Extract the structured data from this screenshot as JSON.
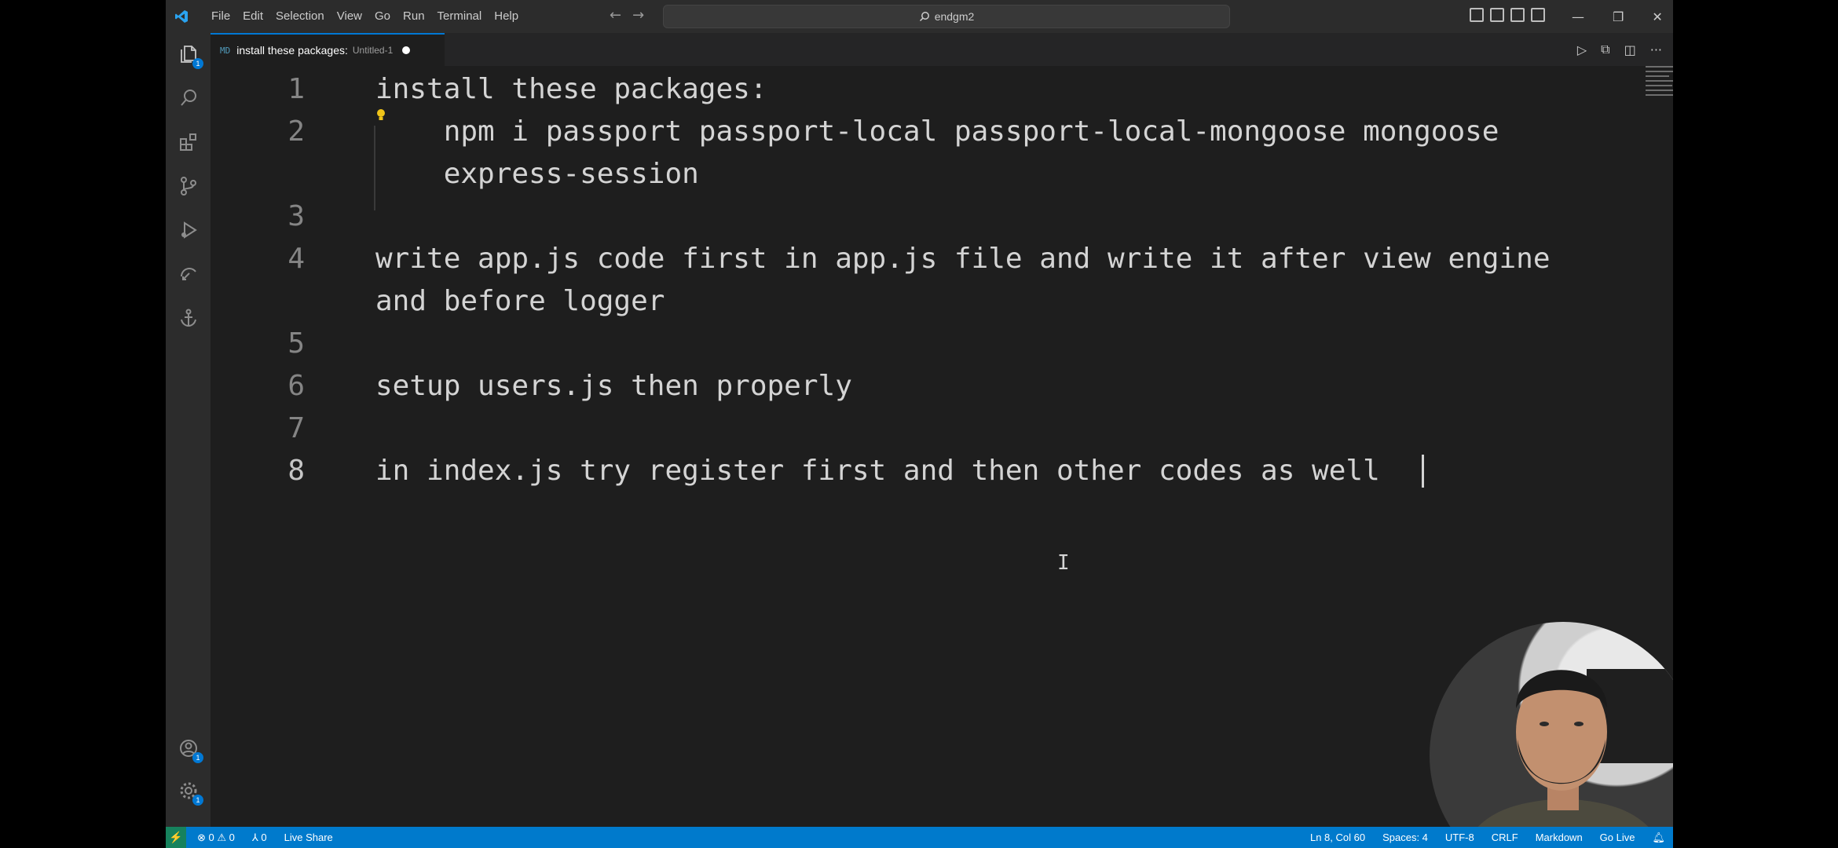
{
  "titlebar": {
    "menu": [
      "File",
      "Edit",
      "Selection",
      "View",
      "Go",
      "Run",
      "Terminal",
      "Help"
    ],
    "search_text": "endgm2",
    "icons": [
      "vscode-logo-icon",
      "back-arrow-icon",
      "forward-arrow-icon",
      "search-icon",
      "layout-icon",
      "minimize-icon",
      "restore-icon",
      "close-icon"
    ]
  },
  "activitybar": {
    "items": [
      {
        "name": "explorer-icon",
        "badge": "1"
      },
      {
        "name": "search-icon",
        "badge": ""
      },
      {
        "name": "extensions-icon",
        "badge": ""
      },
      {
        "name": "source-control-icon",
        "badge": ""
      },
      {
        "name": "run-debug-icon",
        "badge": ""
      },
      {
        "name": "remote-explorer-icon",
        "badge": ""
      },
      {
        "name": "anchor-icon",
        "badge": ""
      }
    ],
    "bottom": [
      {
        "name": "accounts-icon",
        "badge": "1"
      },
      {
        "name": "manage-gear-icon",
        "badge": "1"
      }
    ]
  },
  "tab": {
    "file_icon": "MD",
    "name": "install these packages:",
    "desc": "Untitled-1"
  },
  "editor": {
    "lines": [
      {
        "num": "1",
        "text": "install these packages:"
      },
      {
        "num": "2",
        "text": "    npm i passport passport-local passport-local-mongoose mongoose"
      },
      {
        "num": "",
        "text": "    express-session"
      },
      {
        "num": "3",
        "text": ""
      },
      {
        "num": "4",
        "text": "write app.js code first in app.js file and write it after view engine"
      },
      {
        "num": "",
        "text": "and before logger"
      },
      {
        "num": "5",
        "text": ""
      },
      {
        "num": "6",
        "text": "setup users.js then properly"
      },
      {
        "num": "7",
        "text": ""
      },
      {
        "num": "8",
        "text": "in index.js try register first and then other codes as well"
      }
    ]
  },
  "statusbar": {
    "remote": "⚡",
    "problems": "⊗ 0 ⚠ 0",
    "ports": "⅄ 0",
    "liveshare": "Live Share",
    "position": "Ln 8, Col 60",
    "spaces": "Spaces: 4",
    "encoding": "UTF-8",
    "eol": "CRLF",
    "language": "Markdown",
    "golive": "Go Live"
  },
  "colors": {
    "accent": "#007acc",
    "editor_bg": "#1e1e1e",
    "chrome_bg": "#2c2c2c",
    "text": "#d4d4d4",
    "line_number": "#858585"
  }
}
